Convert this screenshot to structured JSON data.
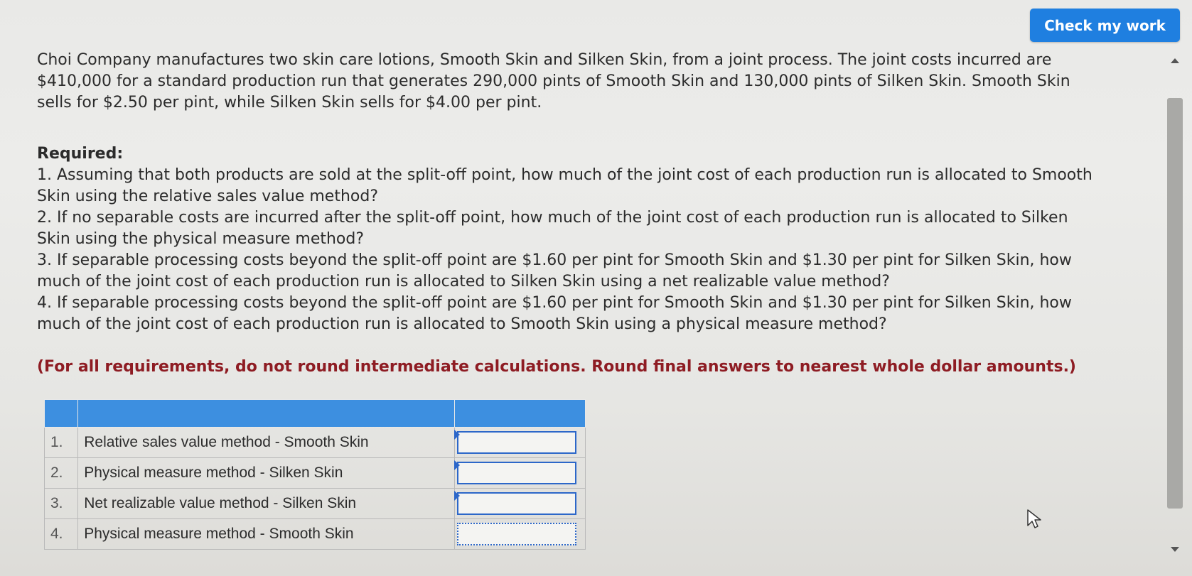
{
  "header": {
    "check_button_label": "Check my work"
  },
  "problem": {
    "lines": [
      "Choi Company manufactures two skin care lotions, Smooth Skin and Silken Skin, from a joint process. The joint costs incurred are",
      "$410,000 for a standard production run that generates 290,000 pints of Smooth Skin and 130,000 pints of Silken Skin. Smooth Skin",
      "sells for $2.50 per pint, while Silken Skin sells for $4.00 per pint."
    ]
  },
  "required": {
    "heading": "Required:",
    "lines": [
      "1. Assuming that both products are sold at the split-off point, how much of the joint cost of each production run is allocated to Smooth",
      "Skin using the relative sales value method?",
      "2. If no separable costs are incurred after the split-off point, how much of the joint cost of each production run is allocated to Silken",
      "Skin using the physical measure method?",
      "3. If separable processing costs beyond the split-off point are $1.60 per pint for Smooth Skin and $1.30 per pint for Silken Skin, how",
      "much of the joint cost of each production run is allocated to Silken Skin using a net realizable value method?",
      "4. If separable processing costs beyond the split-off point are $1.60 per pint for Smooth Skin and $1.30 per pint for Silken Skin, how",
      "much of the joint cost of each production run is allocated to Smooth Skin using a physical measure method?"
    ],
    "note": "(For all requirements, do not round intermediate calculations. Round final answers to nearest whole dollar amounts.)"
  },
  "answer_table": {
    "rows": [
      {
        "number": "1.",
        "label": "Relative sales value method - Smooth Skin",
        "value": ""
      },
      {
        "number": "2.",
        "label": "Physical measure method - Silken Skin",
        "value": ""
      },
      {
        "number": "3.",
        "label": "Net realizable value method - Silken Skin",
        "value": ""
      },
      {
        "number": "4.",
        "label": "Physical measure method - Smooth Skin",
        "value": ""
      }
    ]
  },
  "colors": {
    "accent": "#1f7fe0",
    "table_header": "#3d8fe0",
    "note_text": "#8e1c23"
  },
  "icons": [
    "scroll-up-icon",
    "scroll-down-icon",
    "cursor-icon"
  ]
}
